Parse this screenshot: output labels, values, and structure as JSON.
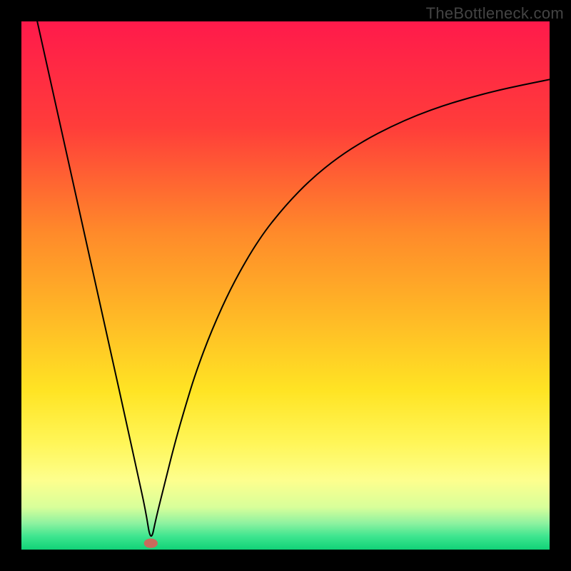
{
  "watermark": "TheBottleneck.com",
  "chart_data": {
    "type": "line",
    "title": "",
    "xlabel": "",
    "ylabel": "",
    "xlim": [
      0,
      100
    ],
    "ylim": [
      0,
      100
    ],
    "grid": false,
    "legend": false,
    "axes_visible": false,
    "background_gradient": {
      "type": "vertical",
      "stops": [
        {
          "pos": 0.0,
          "color": "#ff1a4b"
        },
        {
          "pos": 0.2,
          "color": "#ff3d3a"
        },
        {
          "pos": 0.4,
          "color": "#ff8a2a"
        },
        {
          "pos": 0.55,
          "color": "#ffb626"
        },
        {
          "pos": 0.7,
          "color": "#ffe424"
        },
        {
          "pos": 0.8,
          "color": "#fff659"
        },
        {
          "pos": 0.87,
          "color": "#fdff8e"
        },
        {
          "pos": 0.92,
          "color": "#d8ff9a"
        },
        {
          "pos": 0.95,
          "color": "#8ef2a0"
        },
        {
          "pos": 0.975,
          "color": "#3ee58f"
        },
        {
          "pos": 1.0,
          "color": "#11d277"
        }
      ]
    },
    "marker": {
      "x": 24.5,
      "y": 1.2,
      "color": "#c96a5c",
      "rx": 1.3,
      "ry": 0.9
    },
    "series": [
      {
        "name": "curve",
        "color": "#000000",
        "stroke_width": 2,
        "x": [
          3,
          5,
          8,
          11,
          14,
          17,
          20,
          22,
          23.5,
          24.5,
          25.5,
          27,
          29,
          31,
          33,
          36,
          40,
          45,
          50,
          55,
          60,
          65,
          70,
          75,
          80,
          85,
          90,
          95,
          100
        ],
        "y": [
          100,
          91,
          77.5,
          64,
          50.5,
          37,
          23.5,
          14.3,
          7.5,
          1.2,
          6,
          12,
          20,
          27,
          33.5,
          41.5,
          50.3,
          58.9,
          65.2,
          70.3,
          74.3,
          77.5,
          80.1,
          82.3,
          84.1,
          85.6,
          86.9,
          88,
          89
        ]
      }
    ]
  }
}
